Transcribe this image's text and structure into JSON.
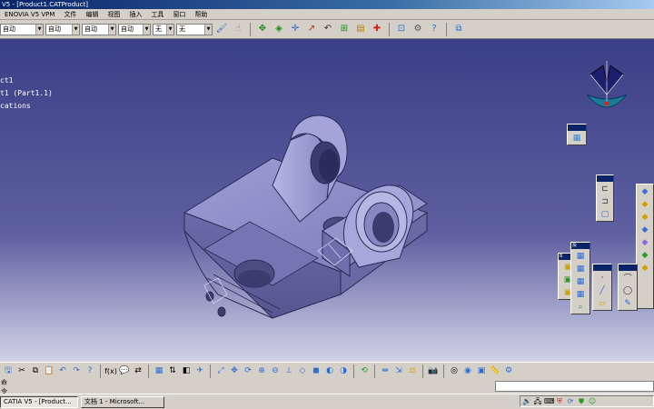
{
  "window": {
    "title": "V5 - [Product1.CATProduct]"
  },
  "menu": [
    "ENOVIA V5 VPM",
    "文件",
    "编辑",
    "视图",
    "插入",
    "工具",
    "窗口",
    "帮助"
  ],
  "toolbar_top": {
    "combos": [
      "自动",
      "自动",
      "自动",
      "自动",
      "无"
    ],
    "icons": [
      "properties-icon",
      "hand-icon",
      "move-icon",
      "snap-icon",
      "measure-icon",
      "analysis-icon",
      "sketch-icon",
      "constraint-icon",
      "colors-icon",
      "catalog-icon",
      "help-icon",
      "product-icon"
    ]
  },
  "tree": {
    "lines": [
      "ct1",
      "t1 (Part1.1)",
      "cations"
    ]
  },
  "palettes": {
    "p1_title": "",
    "p2_title": "",
    "p3_title": "投",
    "p4_title": "B",
    "p5_title": "",
    "p6_title": ""
  },
  "toolbar_bottom": {
    "icons": [
      "save-icon",
      "cut-icon",
      "copy-icon",
      "paste-icon",
      "undo-icon",
      "redo-icon",
      "whatsthis-icon",
      "formula-icon",
      "comment-icon",
      "swap-icon",
      "table-icon",
      "sort-icon",
      "view-icon",
      "fly-icon",
      "pan-icon",
      "rotate-icon",
      "zoom-in-icon",
      "zoom-out-icon",
      "normal-view-icon",
      "iso-view-icon",
      "shading-icon",
      "hide-show-icon",
      "swap-visible-icon",
      "update-icon",
      "measure-between-icon",
      "measure-item-icon",
      "inertia-icon",
      "camera-icon",
      "compass-icon",
      "materials-icon",
      "apply-material-icon"
    ]
  },
  "cmdline": {
    "label": "命令",
    "value": ""
  },
  "taskbar": {
    "buttons": [
      {
        "label": "CATIA V5 - [Product...",
        "active": true
      },
      {
        "label": "文档 1 - Microsoft...",
        "active": false
      }
    ],
    "tray_icons": [
      "volume-icon",
      "network-icon",
      "ime-icon",
      "security-icon",
      "update-icon",
      "shield-icon",
      "msn-icon"
    ]
  },
  "colors": {
    "viewport_top": "#3b3f86",
    "viewport_bottom": "#d2d2e8",
    "titlebar": "#0a246a",
    "part": "#8a8cc6"
  }
}
